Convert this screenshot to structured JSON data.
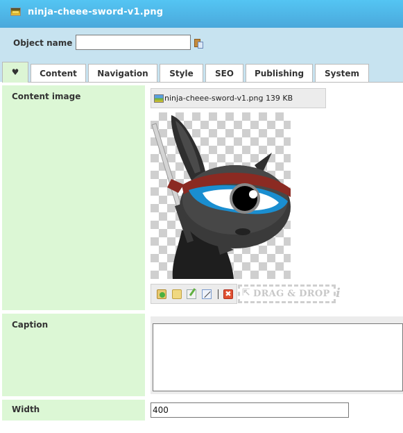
{
  "window": {
    "title": "ninja-cheee-sword-v1.png",
    "icon": "image-file-icon"
  },
  "object_name": {
    "label": "Object name",
    "value": "",
    "paste_icon": "paste-icon"
  },
  "tabs": [
    {
      "label": "♥",
      "icon": "heart-icon",
      "active": true
    },
    {
      "label": "Content",
      "active": false
    },
    {
      "label": "Navigation",
      "active": false
    },
    {
      "label": "Style",
      "active": false
    },
    {
      "label": "SEO",
      "active": false
    },
    {
      "label": "Publishing",
      "active": false
    },
    {
      "label": "System",
      "active": false
    }
  ],
  "content_image": {
    "label": "Content image",
    "file_name": "ninja-cheee-sword-v1.png",
    "file_size": "139 KB",
    "file_display": "ninja-cheee-sword-v1.png 139 KB",
    "preview_alt": "Ninja character with sword",
    "tools": [
      "upload-icon",
      "browse-folder-icon",
      "edit-icon",
      "crop-icon",
      "delete-icon"
    ],
    "delete_glyph": "✖",
    "dropzone_arrow": "⇱",
    "dropzone_label": "DRAG & DROP",
    "info_glyph": "i"
  },
  "caption": {
    "label": "Caption",
    "value": ""
  },
  "width": {
    "label": "Width",
    "value": "400"
  },
  "colors": {
    "titlebar_top": "#54c5f3",
    "titlebar_bottom": "#4aa8db",
    "namebar_bg": "#c7e3f0",
    "label_bg": "#dcf7d5",
    "toolbar_bg": "#ececec"
  }
}
